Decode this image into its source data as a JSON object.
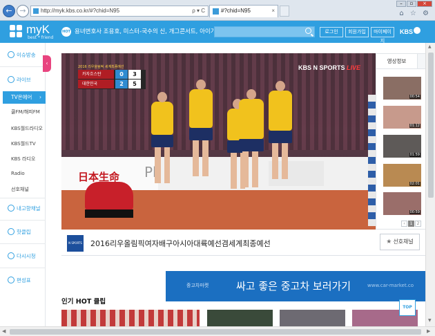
{
  "browser": {
    "address": "http://myk.kbs.co.kr/#?chid=N95",
    "address_tools": "ρ ▾ C",
    "tab_title": "#?chid=N95",
    "tab_close": "×",
    "back_glyph": "←",
    "forward_glyph": "→",
    "toolbar_icons": "⌂ ☆ ⚙",
    "window_buttons": [
      "–",
      "▫",
      "×"
    ]
  },
  "header": {
    "logo_name": "myK",
    "logo_sub": "best * friend",
    "hot_badge": "HOT",
    "ticker": "용녀변호사 조용호, 미스터-국수의 신, 개그콘서트, 아이가 다섯",
    "login": "로그인",
    "signup": "회원가입",
    "mypage": "마이페이지",
    "brand": "KBS"
  },
  "sidebar": {
    "items": [
      {
        "label": "이슈방송",
        "icon": "tv-icon"
      },
      {
        "label": "라이브",
        "icon": "clock-icon"
      }
    ],
    "active": "TV온에어",
    "active_chevron": "›",
    "sub_items": [
      "쿨FM/해피FM",
      "KBS월드라디오",
      "KBS월드TV",
      "KBS 라디오",
      "Radio",
      "선호채널"
    ],
    "lower_items": [
      {
        "label": "내고향채널",
        "icon": "home-icon"
      },
      {
        "label": "핫클립",
        "icon": "play-icon"
      },
      {
        "label": "다시시청",
        "icon": "replay-icon"
      },
      {
        "label": "편성표",
        "icon": "schedule-icon"
      }
    ],
    "collapse_glyph": "‹",
    "accent": "#2f9fe0",
    "active_bg": "#2f9fe0"
  },
  "player": {
    "scoreboard_logo": "2016 리우올림픽 세계최종예선",
    "teams": [
      {
        "name": "카자흐스탄",
        "sets": "0",
        "points": "3"
      },
      {
        "name": "대한민국",
        "sets": "2",
        "points": "5"
      }
    ],
    "broadcaster": "KBS N SPORTS",
    "live": "LIVE",
    "ad_board": "日本生命",
    "ad_board_plus": "Pl"
  },
  "caption": {
    "channel_logo": "N SPORTS",
    "title": "2016리우올림픽여자배구아시아대륙예선겸세계최종예선",
    "favorite": "선호채널",
    "favorite_star": "★"
  },
  "right_panel": {
    "tab": "영상정보",
    "thumbs": [
      {
        "duration": "00:54"
      },
      {
        "duration": "01:12"
      },
      {
        "duration": "01:59"
      },
      {
        "duration": "02:01"
      },
      {
        "duration": "00:59"
      }
    ],
    "pager_prev": "‹",
    "pager_page": "1",
    "pager_next": "2"
  },
  "ad": {
    "brand": "중고차마켓",
    "headline": "싸고 좋은 중고차 보러가기",
    "url": "www.car-market.co"
  },
  "hot_clips": {
    "title": "인기 HOT 클립",
    "top_button": "TOP"
  },
  "scroll": {
    "up": "▲",
    "down": "▼",
    "left": "◀",
    "right": "▶"
  }
}
